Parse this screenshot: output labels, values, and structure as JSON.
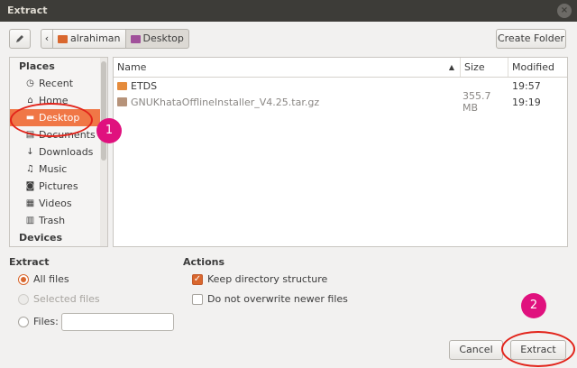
{
  "window": {
    "title": "Extract",
    "close_icon": "×"
  },
  "toolbar": {
    "edit_icon": "pencil-icon",
    "path": [
      {
        "label": "‹"
      },
      {
        "label": "alrahiman"
      },
      {
        "label": "Desktop"
      }
    ],
    "create_folder": "Create Folder"
  },
  "places": {
    "section_places": "Places",
    "items": [
      {
        "label": "Recent",
        "icon": "clock-icon",
        "glyph": "◷"
      },
      {
        "label": "Home",
        "icon": "home-icon",
        "glyph": "⌂"
      },
      {
        "label": "Desktop",
        "icon": "desktop-folder-icon",
        "glyph": "▬"
      },
      {
        "label": "Documents",
        "icon": "documents-icon",
        "glyph": "▤"
      },
      {
        "label": "Downloads",
        "icon": "downloads-icon",
        "glyph": "↓"
      },
      {
        "label": "Music",
        "icon": "music-icon",
        "glyph": "♫"
      },
      {
        "label": "Pictures",
        "icon": "pictures-icon",
        "glyph": "◙"
      },
      {
        "label": "Videos",
        "icon": "videos-icon",
        "glyph": "▦"
      },
      {
        "label": "Trash",
        "icon": "trash-icon",
        "glyph": "▥"
      }
    ],
    "section_devices": "Devices"
  },
  "files": {
    "columns": {
      "name": "Name",
      "size": "Size",
      "modified": "Modified"
    },
    "rows": [
      {
        "name": "ETDS",
        "size": "",
        "modified": "19:57",
        "type": "folder"
      },
      {
        "name": "GNUKhataOfflineInstaller_V4.25.tar.gz",
        "size": "355.7 MB",
        "modified": "19:19",
        "type": "archive"
      }
    ]
  },
  "extract": {
    "heading": "Extract",
    "all_files": "All files",
    "selected_files": "Selected files",
    "files_label": "Files:",
    "files_value": ""
  },
  "actions": {
    "heading": "Actions",
    "keep_structure": "Keep directory structure",
    "no_overwrite": "Do not overwrite newer files"
  },
  "buttons": {
    "cancel": "Cancel",
    "extract": "Extract"
  },
  "annotations": {
    "badge1": "1",
    "badge2": "2"
  },
  "colors": {
    "accent": "#f07746",
    "highlight_ring": "#e2231a",
    "badge": "#e0117e"
  }
}
